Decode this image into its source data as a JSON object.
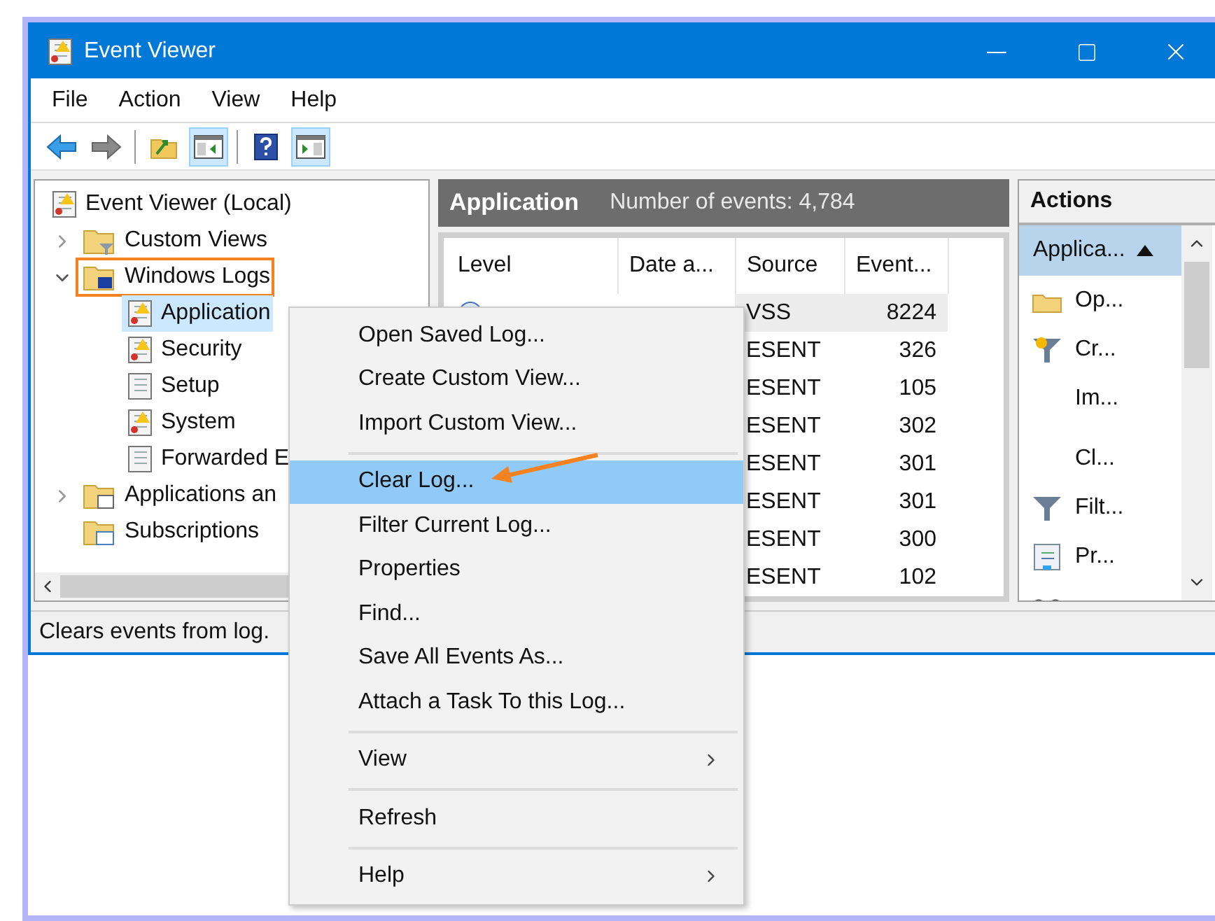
{
  "window": {
    "title": "Event Viewer"
  },
  "menu_bar": [
    "File",
    "Action",
    "View",
    "Help"
  ],
  "toolbar": [
    {
      "kind": "back",
      "pressed": false
    },
    {
      "kind": "forward",
      "pressed": false
    },
    {
      "kind": "separator"
    },
    {
      "kind": "folder-up",
      "pressed": false
    },
    {
      "kind": "tree-pane",
      "pressed": true
    },
    {
      "kind": "separator"
    },
    {
      "kind": "help",
      "pressed": false
    },
    {
      "kind": "action-pane",
      "pressed": true
    }
  ],
  "tree": [
    {
      "label": "Event Viewer (Local)",
      "kind": "log",
      "selected": false,
      "annotated": false,
      "children": [
        {
          "label": "Custom Views",
          "kind": "filter-folder",
          "expanded": false,
          "selected": false,
          "annotated": false
        },
        {
          "label": "Windows Logs",
          "kind": "computer-folder",
          "expanded": true,
          "selected": false,
          "annotated": true,
          "children": [
            {
              "label": "Application",
              "kind": "log",
              "selected": true,
              "annotated": false
            },
            {
              "label": "Security",
              "kind": "log",
              "selected": false,
              "annotated": false
            },
            {
              "label": "Setup",
              "kind": "plain-log",
              "selected": false,
              "annotated": false
            },
            {
              "label": "System",
              "kind": "log",
              "selected": false,
              "annotated": false
            },
            {
              "label": "Forwarded E",
              "kind": "plain-log",
              "selected": false,
              "annotated": false
            }
          ]
        },
        {
          "label": "Applications an",
          "kind": "window-folder",
          "expanded": false,
          "selected": false,
          "annotated": false
        },
        {
          "label": "Subscriptions",
          "kind": "calendar-folder",
          "selected": false,
          "annotated": false
        }
      ]
    }
  ],
  "events": {
    "title": "Application",
    "count": "Number of events: 4,784",
    "columns": [
      "Level",
      "Date a...",
      "Source",
      "Event..."
    ],
    "rows": [
      {
        "source": "VSS",
        "event_id": "8224",
        "selected": true
      },
      {
        "source": "ESENT",
        "event_id": "326",
        "selected": false
      },
      {
        "source": "ESENT",
        "event_id": "105",
        "selected": false
      },
      {
        "source": "ESENT",
        "event_id": "302",
        "selected": false
      },
      {
        "source": "ESENT",
        "event_id": "301",
        "selected": false
      },
      {
        "source": "ESENT",
        "event_id": "301",
        "selected": false
      },
      {
        "source": "ESENT",
        "event_id": "300",
        "selected": false
      },
      {
        "source": "ESENT",
        "event_id": "102",
        "selected": false
      }
    ]
  },
  "actions": {
    "title": "Actions",
    "group": {
      "label": "Applica...",
      "expanded": true
    },
    "items": [
      {
        "kind": "folder",
        "label": "Op..."
      },
      {
        "kind": "filter-star",
        "label": "Cr..."
      },
      {
        "kind": "none",
        "label": "Im..."
      },
      {
        "kind": "separator"
      },
      {
        "kind": "none",
        "label": "Cl..."
      },
      {
        "kind": "filter",
        "label": "Filt..."
      },
      {
        "kind": "properties",
        "label": "Pr..."
      },
      {
        "kind": "binoculars"
      }
    ]
  },
  "status_bar": "Clears events from log.",
  "context_menu": [
    {
      "kind": "item",
      "label": "Open Saved Log...",
      "selected": false,
      "annotated": false
    },
    {
      "kind": "item",
      "label": "Create Custom View...",
      "selected": false,
      "annotated": false
    },
    {
      "kind": "item",
      "label": "Import Custom View...",
      "selected": false,
      "annotated": false
    },
    {
      "kind": "separator"
    },
    {
      "kind": "item",
      "label": "Clear Log...",
      "selected": true,
      "annotated": true
    },
    {
      "kind": "item",
      "label": "Filter Current Log...",
      "selected": false,
      "annotated": false
    },
    {
      "kind": "item",
      "label": "Properties",
      "selected": false,
      "annotated": false
    },
    {
      "kind": "item",
      "label": "Find...",
      "selected": false,
      "annotated": false
    },
    {
      "kind": "item",
      "label": "Save All Events As...",
      "selected": false,
      "annotated": false
    },
    {
      "kind": "item",
      "label": "Attach a Task To this Log...",
      "selected": false,
      "annotated": false
    },
    {
      "kind": "separator"
    },
    {
      "kind": "submenu",
      "label": "View",
      "selected": false,
      "annotated": false
    },
    {
      "kind": "separator"
    },
    {
      "kind": "item",
      "label": "Refresh",
      "selected": false,
      "annotated": false
    },
    {
      "kind": "separator"
    },
    {
      "kind": "submenu",
      "label": "Help",
      "selected": false,
      "annotated": false
    }
  ]
}
